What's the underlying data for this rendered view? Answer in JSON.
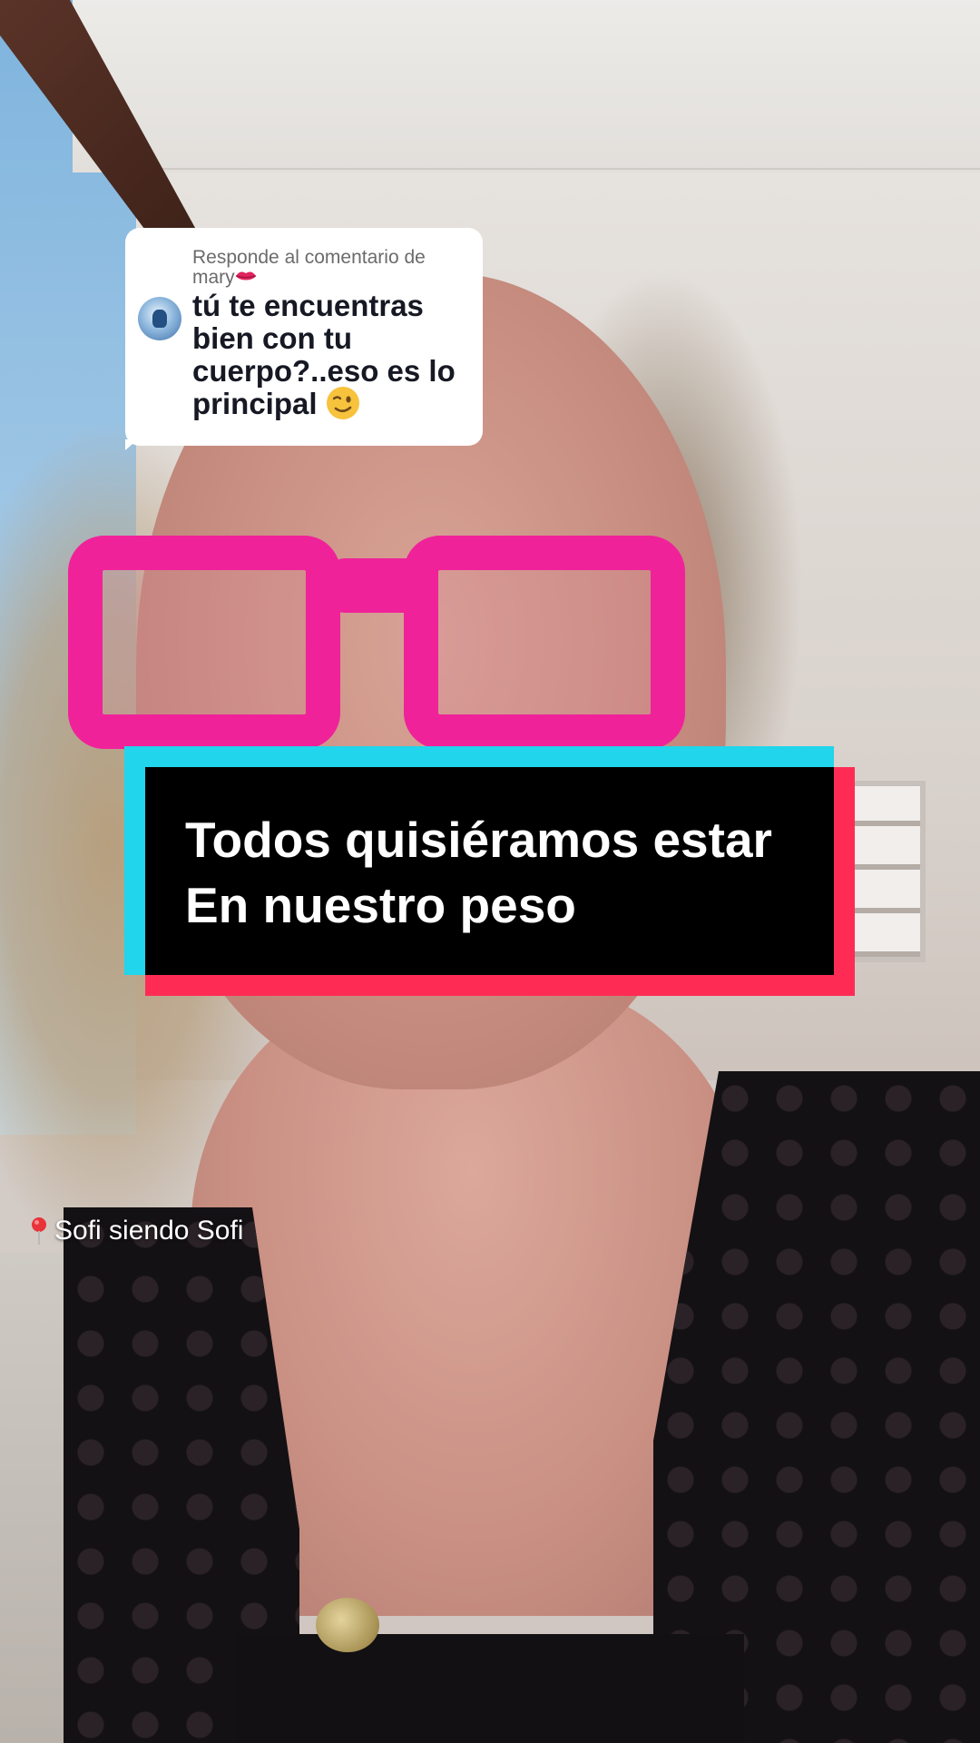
{
  "reply_sticker": {
    "header_prefix": "Responde al comentario de",
    "commenter_name": "mary",
    "commenter_emoji_icon": "lips-icon",
    "comment_text": "tú te encuentras bien con tu cuerpo?..eso es lo principal",
    "comment_emoji_icon": "winking-face-icon"
  },
  "caption": {
    "line1": "Todos quisiéramos estar",
    "line2": "En nuestro peso",
    "colors": {
      "text": "#ffffff",
      "background": "#000000",
      "shadow_cyan": "#20d5ec",
      "shadow_red": "#fe2c55"
    }
  },
  "location": {
    "icon": "location-pin-icon",
    "label": "Sofi siendo Sofi"
  }
}
